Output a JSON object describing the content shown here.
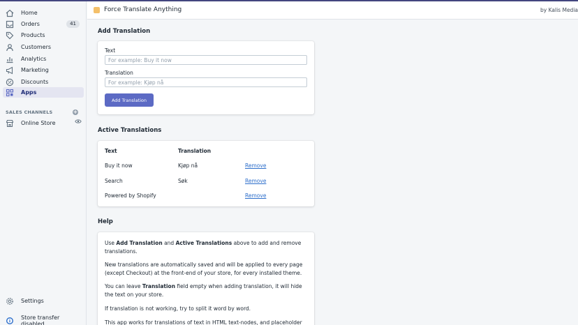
{
  "sidebar": {
    "items": [
      {
        "label": "Home",
        "icon": "home-icon"
      },
      {
        "label": "Orders",
        "icon": "orders-icon",
        "badge": "41"
      },
      {
        "label": "Products",
        "icon": "tag-icon"
      },
      {
        "label": "Customers",
        "icon": "person-icon"
      },
      {
        "label": "Analytics",
        "icon": "chart-icon"
      },
      {
        "label": "Marketing",
        "icon": "megaphone-icon"
      },
      {
        "label": "Discounts",
        "icon": "discount-icon"
      },
      {
        "label": "Apps",
        "icon": "apps-icon",
        "active": true
      }
    ],
    "sales_channels_title": "SALES CHANNELS",
    "online_store": "Online Store",
    "settings": "Settings",
    "store_transfer": "Store transfer disabled"
  },
  "header": {
    "title": "Force Translate Anything",
    "byline": "by Kalis Media"
  },
  "add_translation": {
    "heading": "Add Translation",
    "text_label": "Text",
    "text_placeholder": "For example: Buy it now",
    "translation_label": "Translation",
    "translation_placeholder": "For example: Kjøp nå",
    "button": "Add Translation"
  },
  "active_translations": {
    "heading": "Active Translations",
    "col_text": "Text",
    "col_translation": "Translation",
    "rows": [
      {
        "text": "Buy it now",
        "translation": "Kjøp nå",
        "action": "Remove"
      },
      {
        "text": "Search",
        "translation": "Søk",
        "action": "Remove"
      },
      {
        "text": "Powered by Shopify",
        "translation": "",
        "action": "Remove"
      }
    ]
  },
  "help": {
    "heading": "Help",
    "p1_a": "Use ",
    "p1_b": "Add Translation",
    "p1_c": " and ",
    "p1_d": "Active Translations",
    "p1_e": " above to add and remove translations.",
    "p2": "New translations are automatically saved and will be applied to every page (except Checkout) at the front-end of your store, for every installed theme.",
    "p3_a": "You can leave ",
    "p3_b": "Translation",
    "p3_c": " field empty when adding translation, it will hide the text on your store.",
    "p4": "If translation is not working, try to split it word by word.",
    "p5": "This app works for translations of text in HTML text-nodes, and placeholder text"
  },
  "colors": {
    "accent": "#5c6ac4",
    "active_nav_bg": "#e4e5f1",
    "link": "#2c6ecb",
    "topline": "#43467f"
  }
}
